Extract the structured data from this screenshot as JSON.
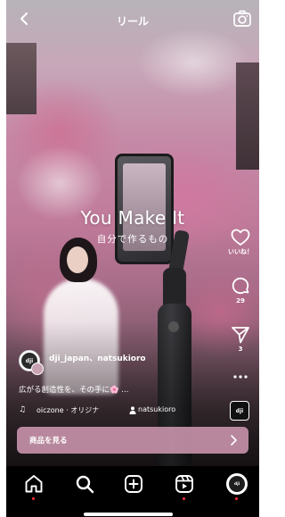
{
  "header": {
    "title": "リール"
  },
  "video": {
    "overlay_title": "You Make It",
    "overlay_subtitle": "自分で作るもの"
  },
  "actions": {
    "like_count": "いいね！",
    "comment_count": "29",
    "share_count": "3"
  },
  "post": {
    "account_names": "dji_japan、natsukioro",
    "caption": "広がる創造性を、その手に🌸 ...",
    "music": "oiczone · オリジナ",
    "tagged_user": "natsukioro",
    "avatar_text": "dji",
    "audio_thumb_text": "dji"
  },
  "shop": {
    "label": "商品を見る"
  },
  "nav": {
    "items": [
      "home-icon",
      "search-icon",
      "create-icon",
      "reels-icon",
      "profile-avatar"
    ],
    "profile_text": "dji"
  },
  "colors": {
    "shop_button": "#cd96af",
    "notification_dot": "#ff3040",
    "background": "#000000"
  }
}
